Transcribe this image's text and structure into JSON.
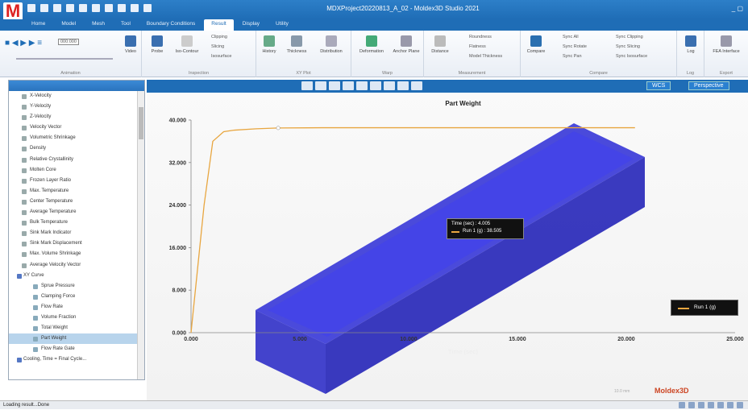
{
  "app": {
    "title": "MDXProject20220813_A_02 - Moldex3D Studio 2021",
    "logo": "M"
  },
  "tabs": [
    "Home",
    "Model",
    "Mesh",
    "Tool",
    "Boundary Conditions",
    "Result",
    "Display",
    "Utility"
  ],
  "active_tab": "Result",
  "ribbon": {
    "animation": {
      "label": "Animation",
      "counter": "000:000",
      "video": "Video"
    },
    "inspection": {
      "label": "Inspection",
      "probe": "Probe",
      "iso_contour": "Iso-Contour",
      "clipping": "Clipping",
      "slicing": "Slicing",
      "isosurface": "Isosurface"
    },
    "xyplot": {
      "label": "XY Plot",
      "history": "History",
      "thickness": "Thickness",
      "distribution": "Distribution"
    },
    "warp": {
      "label": "Warp",
      "deformation": "Deformation",
      "anchor_plane": "Anchor Plane"
    },
    "measurement": {
      "label": "Measurement",
      "distance": "Distance",
      "roundness": "Roundness",
      "flatness": "Flatness",
      "model_thickness": "Model Thickness"
    },
    "compare": {
      "label": "Compare",
      "compare": "Compare",
      "sync_all": "Sync All",
      "sync_rotate": "Sync Rotate",
      "sync_pan": "Sync Pan",
      "sync_clipping": "Sync Clipping",
      "sync_slicing": "Sync Slicing",
      "sync_isosurface": "Sync Isosurface"
    },
    "log": {
      "label": "Log",
      "log": "Log"
    },
    "export": {
      "label": "Export",
      "fea": "FEA Interface"
    }
  },
  "tree": {
    "items": [
      {
        "label": "X-Velocity",
        "level": 1
      },
      {
        "label": "Y-Velocity",
        "level": 1
      },
      {
        "label": "Z-Velocity",
        "level": 1
      },
      {
        "label": "Velocity Vector",
        "level": 1
      },
      {
        "label": "Volumetric Shrinkage",
        "level": 1
      },
      {
        "label": "Density",
        "level": 1
      },
      {
        "label": "Relative Crystallinity",
        "level": 1
      },
      {
        "label": "Molten Core",
        "level": 1
      },
      {
        "label": "Frozen Layer Ratio",
        "level": 1
      },
      {
        "label": "Max. Temperature",
        "level": 1
      },
      {
        "label": "Center Temperature",
        "level": 1
      },
      {
        "label": "Average Temperature",
        "level": 1
      },
      {
        "label": "Bulk Temperature",
        "level": 1
      },
      {
        "label": "Sink Mark Indicator",
        "level": 1
      },
      {
        "label": "Sink Mark Displacement",
        "level": 1
      },
      {
        "label": "Max. Volume Shrinkage",
        "level": 1
      },
      {
        "label": "Average Velocity Vector",
        "level": 1
      },
      {
        "label": "XY Curve",
        "level": 0
      },
      {
        "label": "Sprue Pressure",
        "level": 2
      },
      {
        "label": "Clamping Force",
        "level": 2
      },
      {
        "label": "Flow Rate",
        "level": 2
      },
      {
        "label": "Volume Fraction",
        "level": 2
      },
      {
        "label": "Total Weight",
        "level": 2
      },
      {
        "label": "Part Weight",
        "level": 2,
        "selected": true
      },
      {
        "label": "Flow Rate Gate",
        "level": 2
      },
      {
        "label": "Cooling, Time = Final Cycle...",
        "level": 0
      }
    ]
  },
  "viewport": {
    "wcs": "WCS",
    "projection": "Perspective",
    "unit": "10.0 mm",
    "brand": "Moldex3D"
  },
  "tooltip": {
    "line1": "Time (sec) : 4.005",
    "line2": "Run 1 (g) :  38.505"
  },
  "legend": {
    "label": "Run 1 (g)"
  },
  "status": {
    "text": "Loading result...Done"
  },
  "chart_data": {
    "type": "line",
    "title": "Part Weight",
    "xlabel": "Time (sec)",
    "ylabel": "",
    "xlim": [
      0,
      25
    ],
    "ylim": [
      0,
      40
    ],
    "xticks": [
      "0.000",
      "5.000",
      "10.000",
      "15.000",
      "20.000",
      "25.000"
    ],
    "yticks": [
      "0.000",
      "8.000",
      "16.000",
      "24.000",
      "32.000",
      "40.000"
    ],
    "series": [
      {
        "name": "Run 1 (g)",
        "color": "#e8a640",
        "x": [
          0,
          0.6,
          1.0,
          1.5,
          2.0,
          3.0,
          4.005,
          6.0,
          10.0,
          15.0,
          20.4
        ],
        "y": [
          0,
          24.0,
          36.0,
          37.8,
          38.1,
          38.35,
          38.505,
          38.55,
          38.55,
          38.55,
          38.55
        ]
      }
    ],
    "marker": {
      "x": 4.005,
      "y": 38.505
    }
  }
}
